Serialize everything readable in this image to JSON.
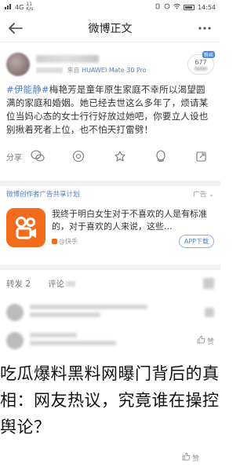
{
  "status_bar": {
    "carrier_signal": "4G",
    "net_speed_value": "11",
    "net_speed_unit": "K/s",
    "time": "14:54"
  },
  "nav": {
    "title": "微博正文"
  },
  "post": {
    "meta_prefix": "来自",
    "device": "HUAWEI Mate 30 Pro",
    "follow_count": "677",
    "follow_tag": "粉丝",
    "hashtag": "#伊能静#",
    "text": "梅艳芳是童年原生家庭不幸所以渴望圆满的家庭和婚姻。她已经去世这么多年了，烦请某位当妈心态的女士行行好放过她吧，你要立人设也别揪着死者上位，也不怕天打雷劈！",
    "share_label": "分享"
  },
  "ad": {
    "sponsor": "微博创作者广告共享计划",
    "tag": "广告",
    "text": "我终于明白女生对于不喜欢的人是有标准的，对于喜欢的人来说，这些...",
    "source": "@快手",
    "button": "APP下载"
  },
  "tabs": {
    "repost": "转发 2",
    "comments": "评论",
    "likes": "赞"
  },
  "comment": {
    "like_label": "赞"
  },
  "overlay": {
    "headline": "吃瓜爆料黑料网曝门背后的真相：网友热议，究竟谁在操控舆论？"
  },
  "bottom": {
    "like_label": "赞"
  },
  "colors": {
    "link_blue": "#4f7fb9",
    "kuaishou_orange": "#f36b1c",
    "divider_gray": "#f2f2f2"
  }
}
